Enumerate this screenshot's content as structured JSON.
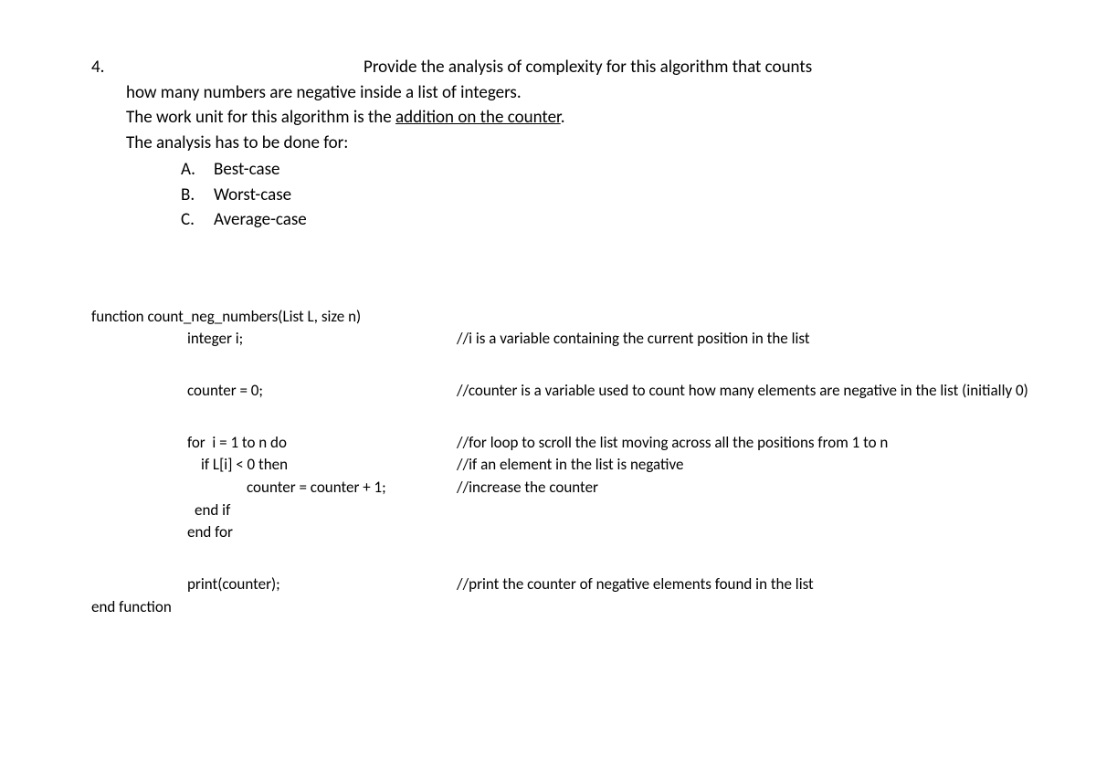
{
  "question": {
    "number": "4.",
    "line1_right": "Provide the analysis of complexity for this algorithm that counts",
    "line2": "how many numbers are negative inside a list of integers.",
    "line3_pre": "The work unit for this algorithm is the ",
    "line3_underlined": "addition on the counter",
    "line3_post": ".",
    "line4": "The analysis has to be done for:",
    "items": [
      {
        "letter": "A.",
        "text": "Best-case"
      },
      {
        "letter": "B.",
        "text": "Worst-case"
      },
      {
        "letter": "C.",
        "text": "Average-case"
      }
    ]
  },
  "code": [
    {
      "indent": 0,
      "code": "function count_neg_numbers(List L, size n)",
      "comment": ""
    },
    {
      "indent": 105,
      "code": "integer i;",
      "comment": "//i is a variable containing the current position in the list"
    },
    {
      "gap": "lg"
    },
    {
      "indent": 105,
      "code": "counter = 0;",
      "comment": "//counter is a variable used to count how many elements are negative in the list (initially 0)"
    },
    {
      "gap": "lg"
    },
    {
      "indent": 105,
      "code": "for  i = 1 to n do",
      "comment": "//for loop to scroll the list moving across all the positions from 1 to n"
    },
    {
      "indent": 120,
      "code": "if L[i] < 0 then",
      "comment": "//if an element in the list is negative"
    },
    {
      "indent": 170,
      "code": "counter = counter + 1;",
      "comment": "//increase the counter"
    },
    {
      "indent": 113,
      "code": "end if",
      "comment": ""
    },
    {
      "indent": 105,
      "code": "end for",
      "comment": ""
    },
    {
      "gap": "lg"
    },
    {
      "indent": 105,
      "code": "print(counter);",
      "comment": "//print the counter of negative elements found in the list"
    },
    {
      "indent": 0,
      "code": "end function",
      "comment": ""
    }
  ]
}
